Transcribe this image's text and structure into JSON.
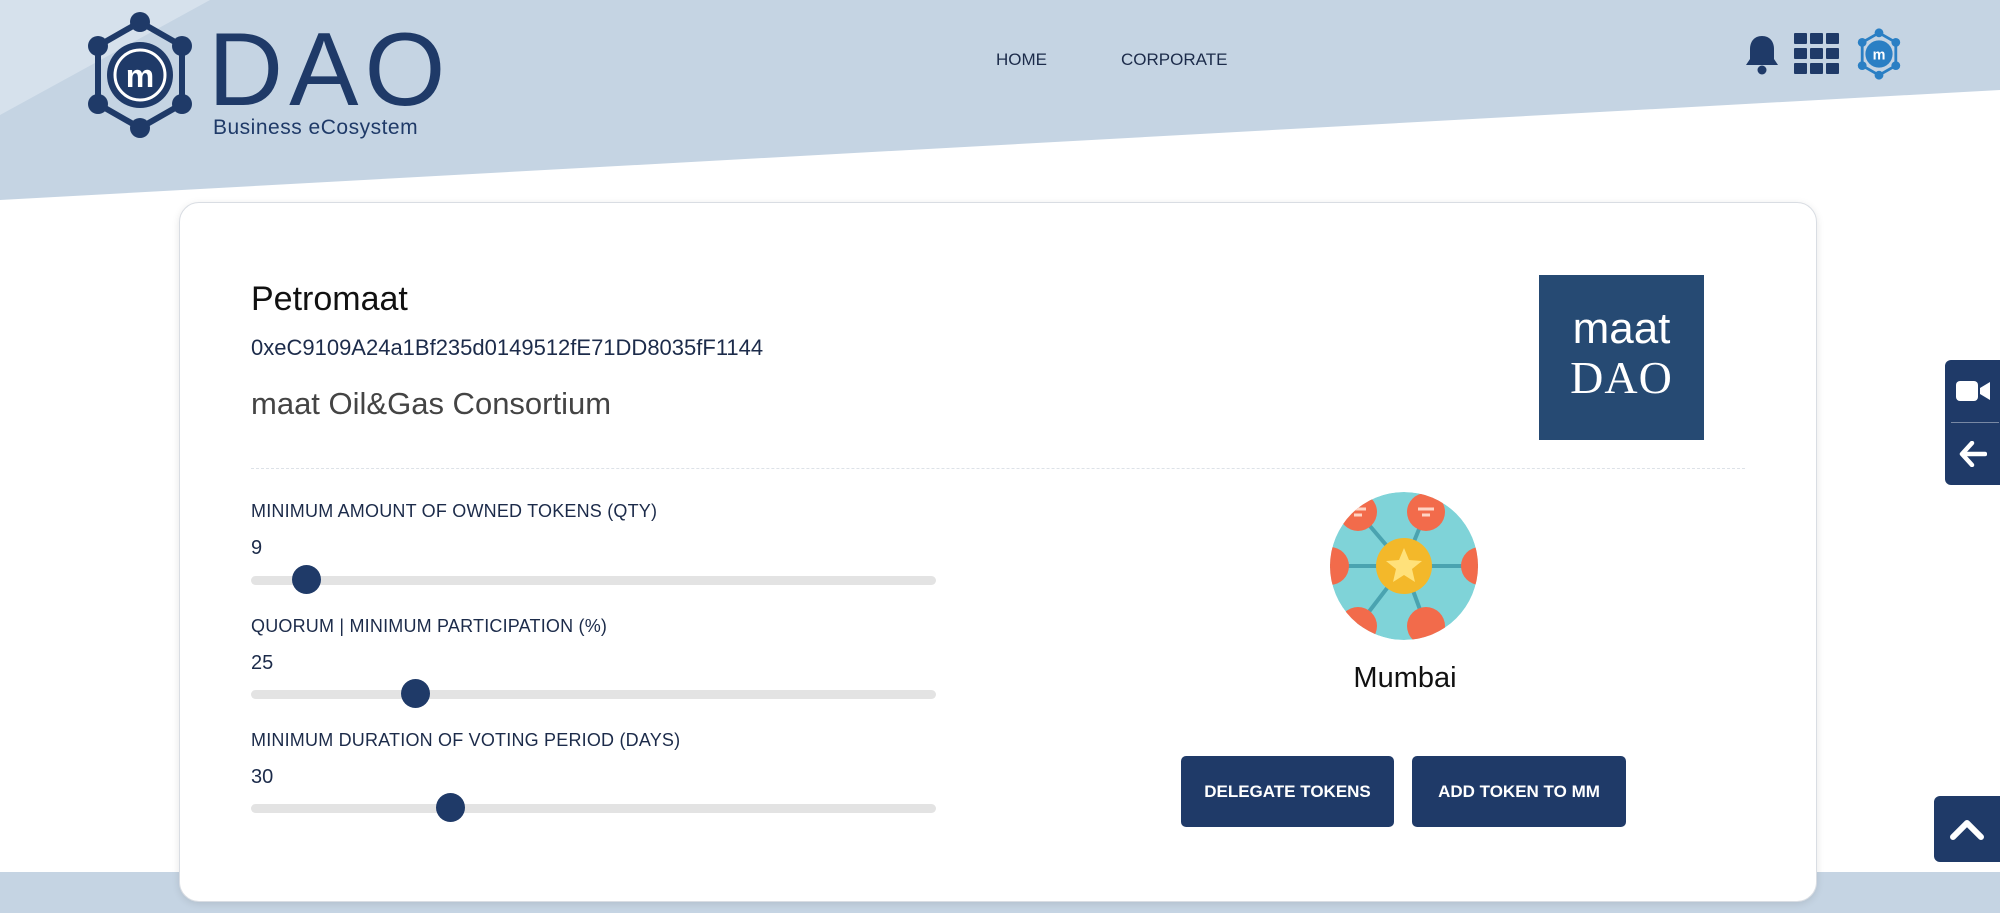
{
  "header": {
    "logo_text": "DAO",
    "logo_tagline": "Business eCosystem",
    "nav": [
      {
        "label": "HOME"
      },
      {
        "label": "CORPORATE"
      }
    ],
    "icons": [
      "bell-icon",
      "app-grid-icon",
      "maat-profile-icon"
    ]
  },
  "dao": {
    "name": "Petromaat",
    "address": "0xeC9109A24a1Bf235d0149512fE71DD8035fF1144",
    "description": "maat Oil&Gas Consortium",
    "logo_line1": "maat",
    "logo_line2": "DAO"
  },
  "params": [
    {
      "label": "MINIMUM AMOUNT OF OWNED TOKENS (QTY)",
      "value": "9",
      "slider_fraction": 0.08
    },
    {
      "label": "QUORUM | MINIMUM PARTICIPATION (%)",
      "value": "25",
      "slider_fraction": 0.24
    },
    {
      "label": "MINIMUM DURATION OF VOTING PERIOD (DAYS)",
      "value": "30",
      "slider_fraction": 0.29
    }
  ],
  "network": {
    "name": "Mumbai",
    "icon": "network-hub-icon"
  },
  "actions": {
    "delegate_label": "DELEGATE TOKENS",
    "add_token_label": "ADD TOKEN TO MM"
  },
  "side_tab": {
    "icons": [
      "video-camera-icon",
      "arrow-left-icon"
    ]
  },
  "scroll_top_icon": "chevron-up-icon",
  "colors": {
    "primary": "#1f3a68",
    "header_bg": "#c5d4e3",
    "brand_box": "#264a73",
    "slider_track": "#e3e3e3"
  }
}
